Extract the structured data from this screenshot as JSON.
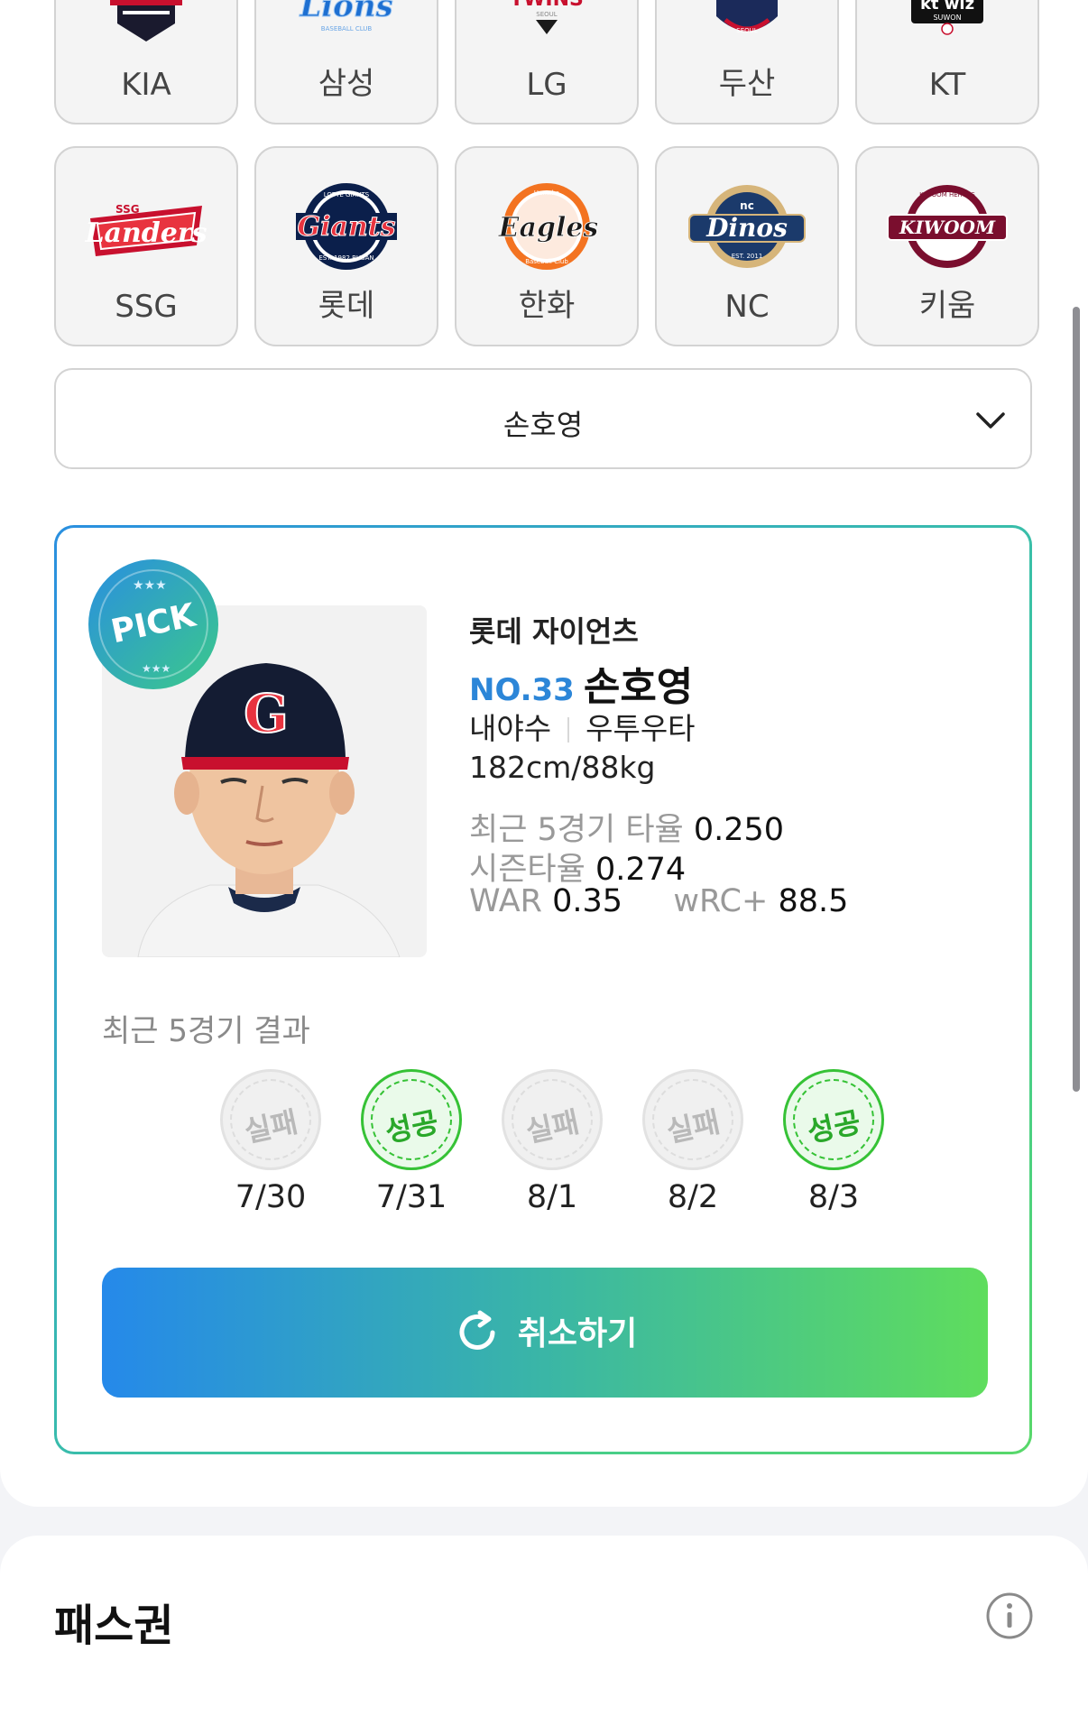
{
  "teams_row1": [
    {
      "name": "KIA",
      "icon": "kia-logo"
    },
    {
      "name": "삼성",
      "icon": "samsung-lions-logo"
    },
    {
      "name": "LG",
      "icon": "lg-twins-logo"
    },
    {
      "name": "두산",
      "icon": "doosan-bears-logo"
    },
    {
      "name": "KT",
      "icon": "kt-wiz-logo"
    }
  ],
  "teams_row2": [
    {
      "name": "SSG",
      "icon": "ssg-landers-logo"
    },
    {
      "name": "롯데",
      "icon": "lotte-giants-logo"
    },
    {
      "name": "한화",
      "icon": "hanwha-eagles-logo"
    },
    {
      "name": "NC",
      "icon": "nc-dinos-logo"
    },
    {
      "name": "키움",
      "icon": "kiwoom-heroes-logo"
    }
  ],
  "logo_text": {
    "kt": "kt wiz",
    "kt_sub": "SUWON",
    "ssg_small": "SSG",
    "ssg": "Landers",
    "lotte": "Giants",
    "hanwha": "Eagles",
    "nc_small": "nc",
    "nc": "Dinos",
    "kiwoom": "KIWOOM",
    "lg": "TWINS",
    "samsung": "Lions"
  },
  "player_select": {
    "value": "손호영"
  },
  "player": {
    "badge": "PICK",
    "team": "롯데 자이언츠",
    "number": "NO.33",
    "name": "손호영",
    "position": "내야수",
    "bats_throws": "우투우타",
    "body": "182cm/88kg",
    "recent5_label": "최근 5경기 타율",
    "recent5_value": "0.250",
    "season_label": "시즌타율",
    "season_value": "0.274",
    "war_label": "WAR",
    "war_value": "0.35",
    "wrc_label": "wRC+",
    "wrc_value": "88.5"
  },
  "results": {
    "title": "최근 5경기 결과",
    "items": [
      {
        "status": "실패",
        "date": "7/30"
      },
      {
        "status": "성공",
        "date": "7/31"
      },
      {
        "status": "실패",
        "date": "8/1"
      },
      {
        "status": "실패",
        "date": "8/2"
      },
      {
        "status": "성공",
        "date": "8/3"
      }
    ]
  },
  "cancel_button": {
    "label": "취소하기",
    "icon": "refresh-icon"
  },
  "pass": {
    "title": "패스권",
    "icon": "info-icon"
  },
  "colors": {
    "accent_blue": "#2c86d8",
    "success_green": "#36c236",
    "gradient_start": "#2589ea",
    "gradient_end": "#5fdd5d"
  }
}
